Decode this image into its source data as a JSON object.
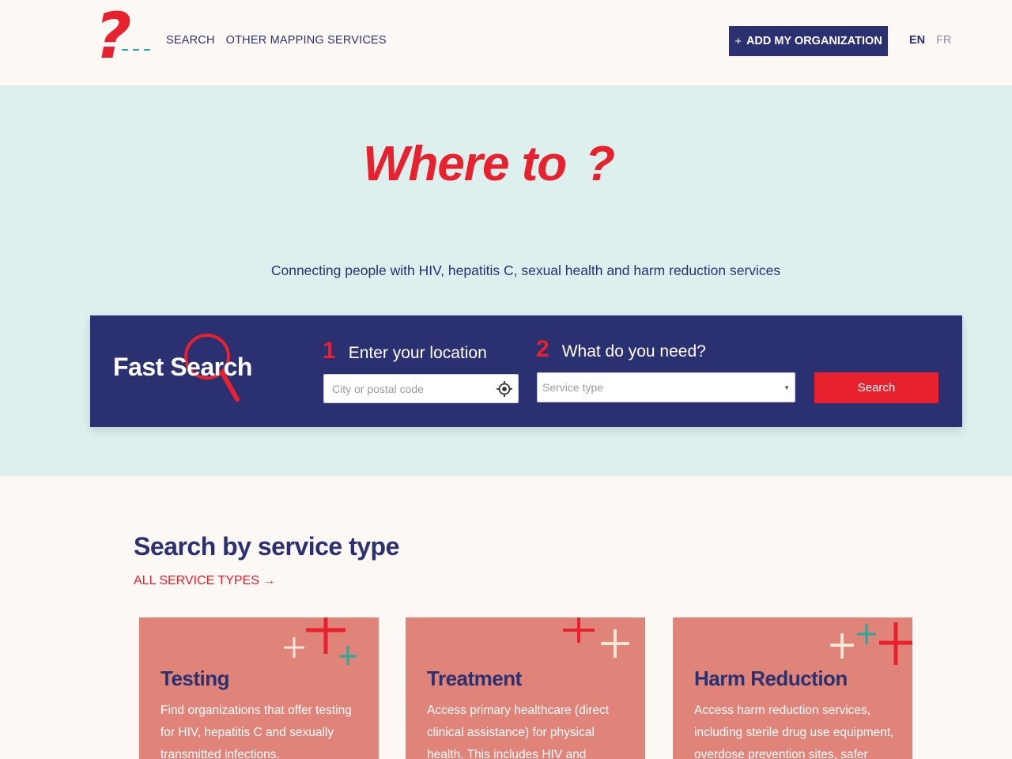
{
  "header": {
    "nav": [
      "SEARCH",
      "OTHER MAPPING SERVICES"
    ],
    "add_button": "ADD MY ORGANIZATION",
    "add_button_icon": "plus-icon",
    "languages": [
      "EN",
      "FR"
    ],
    "active_language": "EN"
  },
  "hero": {
    "title": "Where to",
    "title_mark": "?",
    "tagline": "Connecting people with HIV, hepatitis C, sexual health and harm reduction services"
  },
  "fast_search": {
    "title": "Fast Search",
    "step1": {
      "number": "1",
      "label": "Enter your location",
      "placeholder": "City or postal code",
      "icon": "locate-icon"
    },
    "step2": {
      "number": "2",
      "label": "What do you need?",
      "select_value": "Service type"
    },
    "search_button": "Search"
  },
  "service_types": {
    "title": "Search by service type",
    "all_link": "ALL SERVICE TYPES",
    "cards": [
      {
        "title": "Testing",
        "description": "Find organizations that offer testing for HIV, hepatitis C and sexually transmitted infections."
      },
      {
        "title": "Treatment",
        "description": "Access primary healthcare (direct clinical assistance) for physical health. This includes HIV and hepatitis C"
      },
      {
        "title": "Harm Reduction",
        "description": "Access harm reduction services, including sterile drug use equipment, overdose prevention sites, safer"
      }
    ]
  },
  "colors": {
    "navy": "#2b3170",
    "red": "#e8212e",
    "teal": "#2aa89a",
    "hero_bg": "#def0ee",
    "card_bg": "#e08479",
    "page_bg": "#fdf8f4"
  }
}
